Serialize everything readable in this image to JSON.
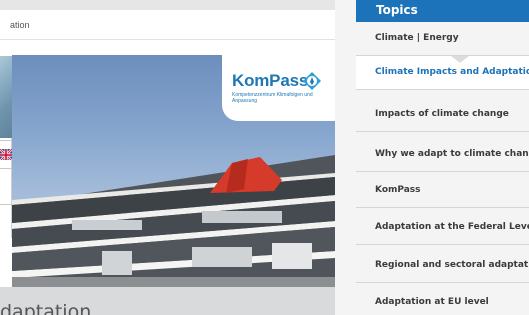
{
  "breadcrumb": {
    "text": "ation"
  },
  "logo": {
    "word": "KomPass",
    "subtitle": "Kompetenzzentrum Klimafolgen und Anpassung"
  },
  "page_heading": {
    "text": "daptation"
  },
  "sidebar": {
    "title": "Topics",
    "items": [
      {
        "label": "Climate | Energy",
        "active": false
      },
      {
        "label": "Climate Impacts and Adaptation",
        "active": true
      },
      {
        "label": "Impacts of climate change",
        "active": false
      },
      {
        "label": "Why we adapt to climate change",
        "active": false
      },
      {
        "label": "KomPass",
        "active": false
      },
      {
        "label": "Adaptation at the Federal Level",
        "active": false
      },
      {
        "label": "Regional and sectoral adaptation",
        "active": false
      },
      {
        "label": "Adaptation at EU level",
        "active": false
      }
    ]
  },
  "colors": {
    "brand_blue": "#1d73b9",
    "logo_blue": "#1f78b4",
    "umbrella_red": "#d63a2a"
  }
}
